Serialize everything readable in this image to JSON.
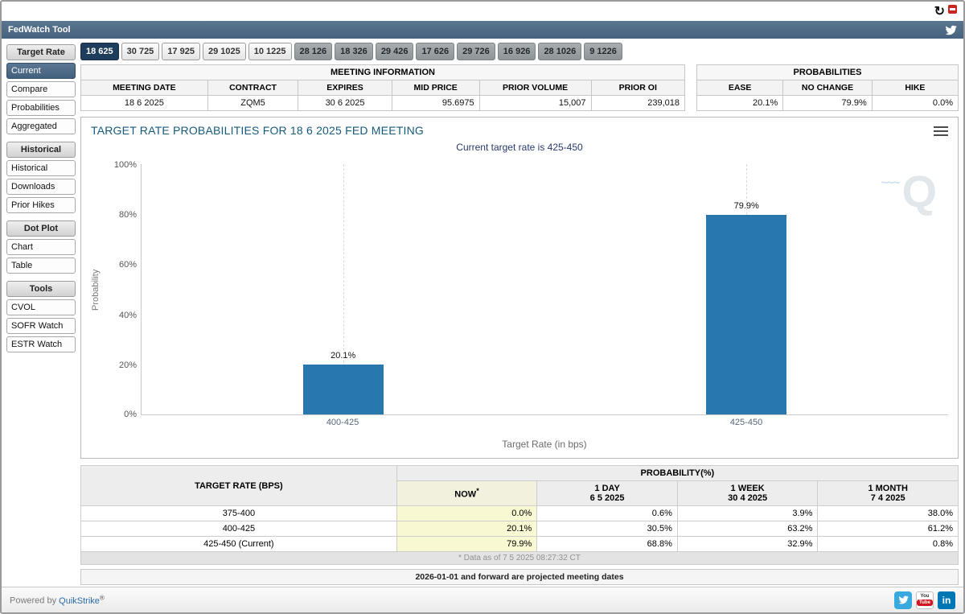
{
  "window": {
    "title": "FedWatch Tool"
  },
  "topbar": {
    "refresh_icon": "↻"
  },
  "sidebar": {
    "sections": [
      {
        "header": "Target Rate",
        "items": [
          {
            "label": "Current",
            "selected": true
          },
          {
            "label": "Compare"
          },
          {
            "label": "Probabilities"
          },
          {
            "label": "Aggregated"
          }
        ]
      },
      {
        "header": "Historical",
        "items": [
          {
            "label": "Historical"
          },
          {
            "label": "Downloads"
          },
          {
            "label": "Prior Hikes"
          }
        ]
      },
      {
        "header": "Dot Plot",
        "items": [
          {
            "label": "Chart"
          },
          {
            "label": "Table"
          }
        ]
      },
      {
        "header": "Tools",
        "items": [
          {
            "label": "CVOL"
          },
          {
            "label": "SOFR Watch"
          },
          {
            "label": "ESTR Watch"
          }
        ]
      }
    ]
  },
  "meeting_tabs": {
    "items": [
      {
        "label": "18 625",
        "selected": true
      },
      {
        "label": "30 725"
      },
      {
        "label": "17 925"
      },
      {
        "label": "29 1025"
      },
      {
        "label": "10 1225"
      },
      {
        "label": "28 126",
        "projected": true
      },
      {
        "label": "18 326",
        "projected": true
      },
      {
        "label": "29 426",
        "projected": true
      },
      {
        "label": "17 626",
        "projected": true
      },
      {
        "label": "29 726",
        "projected": true
      },
      {
        "label": "16 926",
        "projected": true
      },
      {
        "label": "28 1026",
        "projected": true
      },
      {
        "label": "9 1226",
        "projected": true
      }
    ]
  },
  "meeting_info": {
    "title": "MEETING INFORMATION",
    "headers": [
      "MEETING DATE",
      "CONTRACT",
      "EXPIRES",
      "MID PRICE",
      "PRIOR VOLUME",
      "PRIOR OI"
    ],
    "values": [
      "18 6 2025",
      "ZQM5",
      "30 6 2025",
      "95.6975",
      "15,007",
      "239,018"
    ]
  },
  "probabilities_summary": {
    "title": "PROBABILITIES",
    "headers": [
      "EASE",
      "NO CHANGE",
      "HIKE"
    ],
    "values": [
      "20.1%",
      "79.9%",
      "0.0%"
    ]
  },
  "chart_data": {
    "type": "bar",
    "title": "TARGET RATE PROBABILITIES FOR 18 6 2025 FED MEETING",
    "subtitle": "Current target rate is 425-450",
    "categories": [
      "400-425",
      "425-450"
    ],
    "values": [
      20.1,
      79.9
    ],
    "value_labels": [
      "20.1%",
      "79.9%"
    ],
    "xlabel": "Target Rate (in bps)",
    "ylabel": "Probability",
    "ylim": [
      0,
      100
    ],
    "yticks": [
      "100%",
      "80%",
      "60%",
      "40%",
      "20%",
      "0%"
    ],
    "bar_color": "#2878ae",
    "grid": "vertical-dashed",
    "legend": "none",
    "watermark": "Q",
    "watermark_squiggle": "~~~"
  },
  "probability_table": {
    "rate_header": "TARGET RATE (BPS)",
    "group_header": "PROBABILITY(%)",
    "now_label": "NOW",
    "now_marker": "*",
    "columns": [
      {
        "label": "1 DAY",
        "date": "6 5 2025"
      },
      {
        "label": "1 WEEK",
        "date": "30 4 2025"
      },
      {
        "label": "1 MONTH",
        "date": "7 4 2025"
      }
    ],
    "rows": [
      {
        "rate": "375-400",
        "now": "0.0%",
        "day": "0.6%",
        "week": "3.9%",
        "month": "38.0%"
      },
      {
        "rate": "400-425",
        "now": "20.1%",
        "day": "30.5%",
        "week": "63.2%",
        "month": "61.2%"
      },
      {
        "rate": "425-450 (Current)",
        "now": "79.9%",
        "day": "68.8%",
        "week": "32.9%",
        "month": "0.8%"
      }
    ],
    "footnote": "* Data as of 7 5 2025 08:27:32 CT"
  },
  "notes": {
    "projected": "2026-01-01 and forward are projected meeting dates"
  },
  "footer": {
    "powered_by": "Powered by",
    "brand": "QuikStrike",
    "trademark": "®",
    "linkedin_label": "in",
    "youtube_top": "You",
    "youtube_bottom": "Tube"
  },
  "colors": {
    "titlebar": "#47627e",
    "selected_tab": "#1e3d5c",
    "bar": "#2878ae",
    "now_highlight": "#f8f8d2"
  }
}
